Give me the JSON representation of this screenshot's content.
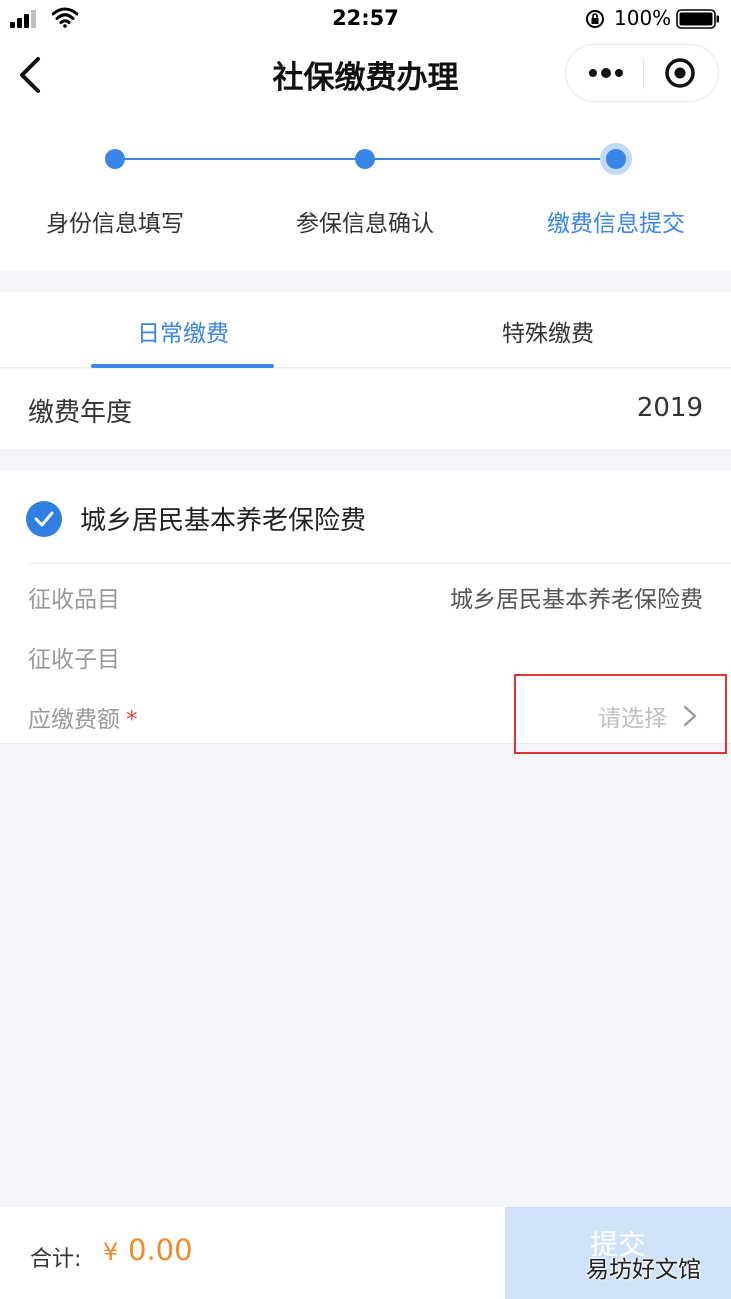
{
  "status_bar": {
    "time": "22:57",
    "battery_percent": "100%"
  },
  "nav": {
    "title": "社保缴费办理",
    "back_icon": "chevron-left-icon",
    "more_icon": "more-dots-icon",
    "target_icon": "target-icon"
  },
  "steps": {
    "items": [
      {
        "label": "身份信息填写",
        "state": "done"
      },
      {
        "label": "参保信息确认",
        "state": "done"
      },
      {
        "label": "缴费信息提交",
        "state": "active"
      }
    ]
  },
  "tabs": {
    "items": [
      {
        "label": "日常缴费",
        "active": true
      },
      {
        "label": "特殊缴费",
        "active": false
      }
    ]
  },
  "year": {
    "label": "缴费年度",
    "value": "2019"
  },
  "insurance": {
    "checked": true,
    "title": "城乡居民基本养老保险费",
    "fields": {
      "category_label": "征收品目",
      "category_value": "城乡居民基本养老保险费",
      "subcategory_label": "征收子目",
      "amount_label": "应缴费额",
      "amount_required_mark": "*",
      "amount_placeholder": "请选择"
    }
  },
  "footer": {
    "total_label": "合计:",
    "currency": "¥",
    "total_value": "0.00",
    "submit_label": "提交"
  },
  "watermark": "易坊好文馆",
  "colors": {
    "accent": "#3a86e8",
    "price": "#f08a2a",
    "required": "#e0443b",
    "highlight_box": "#e8322f"
  }
}
